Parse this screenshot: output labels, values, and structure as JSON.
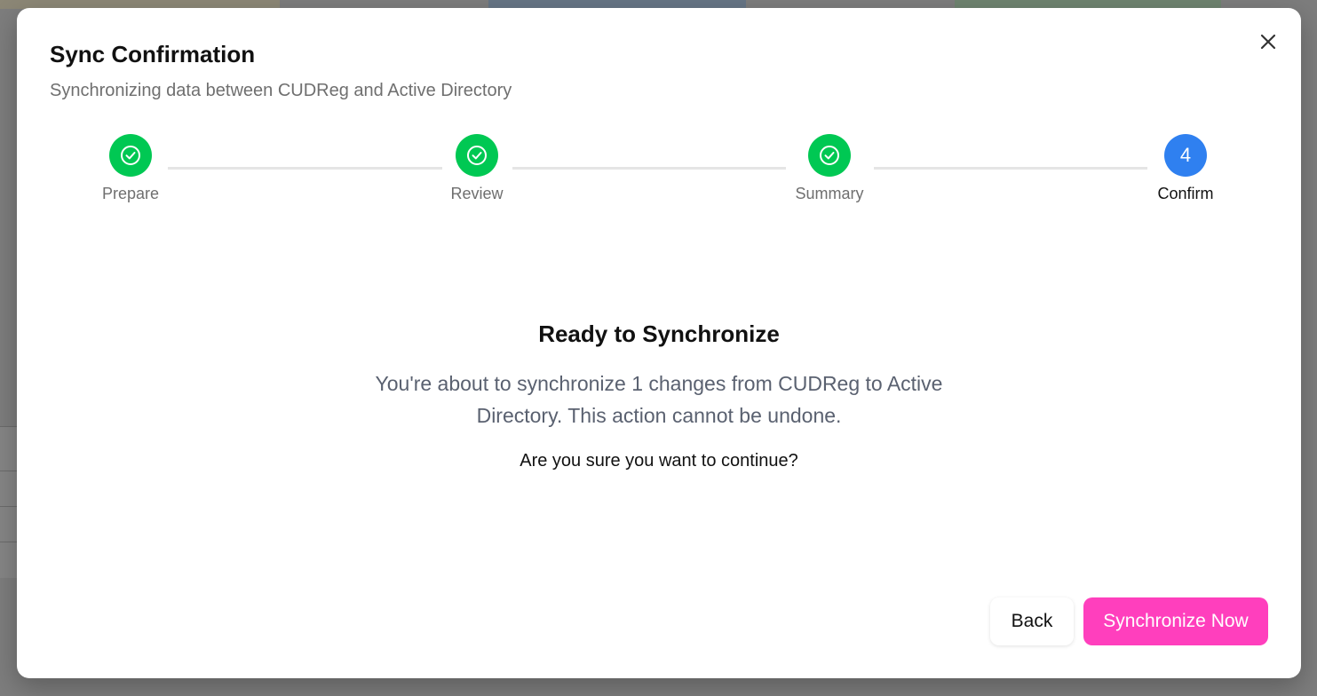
{
  "dialog": {
    "title": "Sync Confirmation",
    "subtitle": "Synchronizing data between CUDReg and Active Directory",
    "close_icon": "close-icon"
  },
  "stepper": {
    "steps": [
      {
        "label": "Prepare",
        "status": "completed"
      },
      {
        "label": "Review",
        "status": "completed"
      },
      {
        "label": "Summary",
        "status": "completed"
      },
      {
        "label": "Confirm",
        "status": "active",
        "number": "4"
      }
    ],
    "completed_color": "#00c853",
    "active_color": "#2f80f0"
  },
  "content": {
    "heading": "Ready to Synchronize",
    "description": "You're about to synchronize 1 changes from CUDReg to Active Directory. This action cannot be undone.",
    "question": "Are you sure you want to continue?"
  },
  "actions": {
    "back_label": "Back",
    "sync_label": "Synchronize Now",
    "sync_color": "#ff3fbd"
  }
}
